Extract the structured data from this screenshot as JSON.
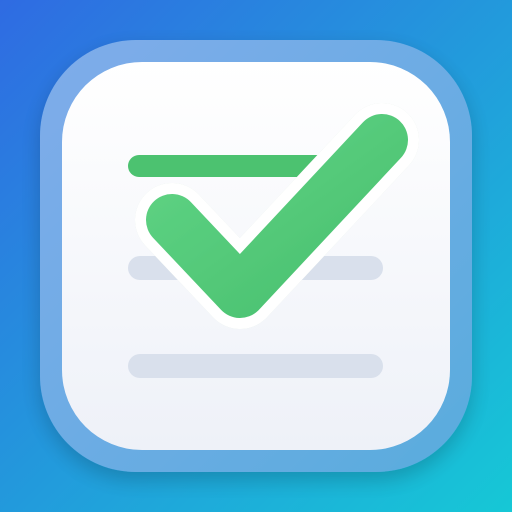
{
  "app_icon": {
    "icon": "checklist-checkmark-icon",
    "colors": {
      "background_top_left": "#2F6BE2",
      "background_bottom_right": "#16C8D6",
      "tile_outer": "#8EB4E8",
      "tile_face": "#F7F8FC",
      "check_green": "#49C06F",
      "check_green_light": "#5FD384",
      "check_outline": "#FFFFFF",
      "line_gray": "#D9E0EC"
    },
    "checklist": {
      "lines": [
        {
          "state": "checked",
          "color": "#4CC270"
        },
        {
          "state": "unchecked",
          "color": "#D9E0EC"
        },
        {
          "state": "unchecked",
          "color": "#D9E0EC"
        }
      ]
    }
  }
}
